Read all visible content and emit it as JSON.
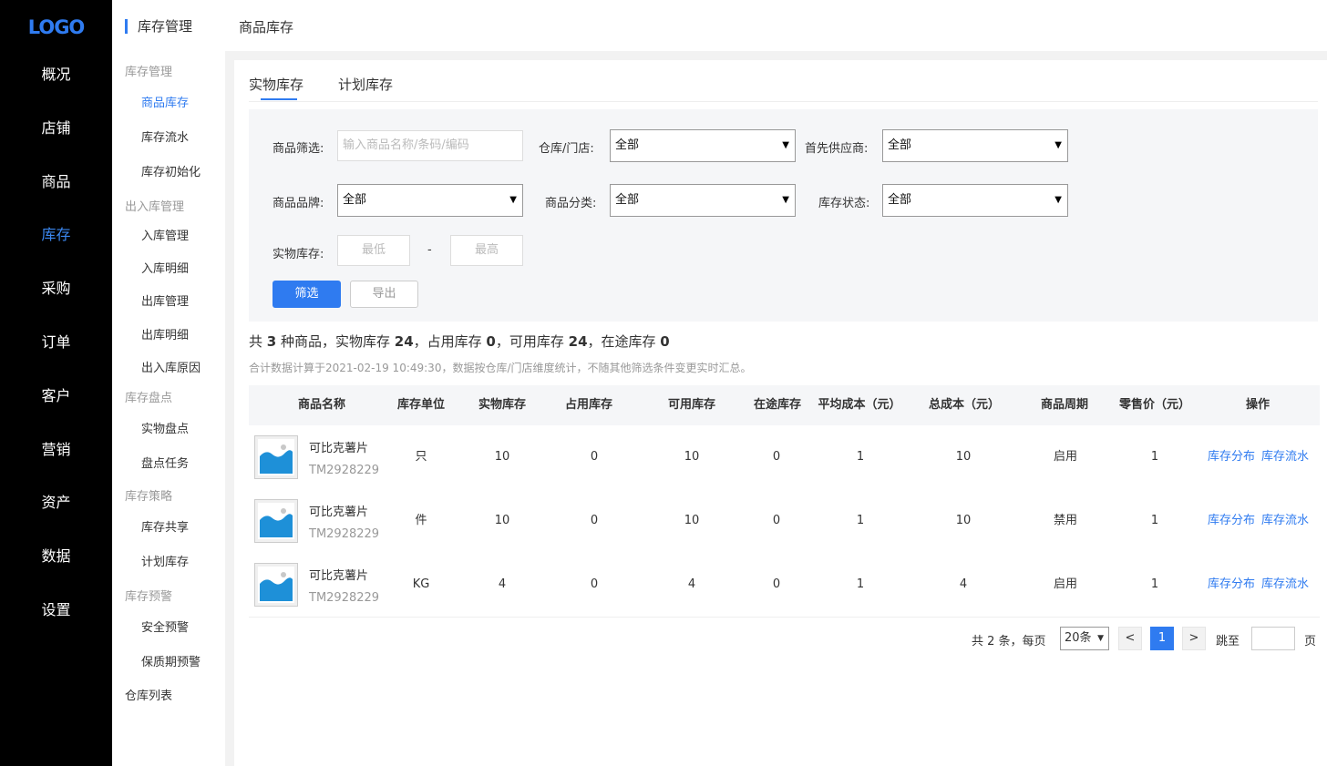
{
  "nav": {
    "logo": "LOGO",
    "items": [
      "概况",
      "店铺",
      "商品",
      "库存",
      "采购",
      "订单",
      "客户",
      "营销",
      "资产",
      "数据",
      "设置"
    ],
    "active_index": 3,
    "active_color": "#3b87ef"
  },
  "subnav": {
    "title": "库存管理",
    "groups": {
      "g1": "库存管理",
      "g1_items": [
        "商品库存",
        "库存流水",
        "库存初始化"
      ],
      "g2": "出入库管理",
      "g2_items": [
        "入库管理",
        "入库明细",
        "出库管理",
        "出库明细",
        "出入库原因"
      ],
      "g3": "库存盘点",
      "g3_items": [
        "实物盘点",
        "盘点任务"
      ],
      "g4": "库存策略",
      "g4_items": [
        "库存共享",
        "计划库存"
      ],
      "g5": "库存预警",
      "g5_items": [
        "安全预警",
        "保质期预警"
      ],
      "root": "仓库列表"
    }
  },
  "topbar": {
    "title": "商品库存"
  },
  "tabs": [
    "实物库存",
    "计划库存"
  ],
  "filter": {
    "product_label": "商品筛选:",
    "product_placeholder": "输入商品名称/条码/编码",
    "warehouse_label": "仓库/门店:",
    "warehouse_value": "全部",
    "supplier_label": "首先供应商:",
    "supplier_value": "全部",
    "brand_label": "商品品牌:",
    "brand_value": "全部",
    "category_label": "商品分类:",
    "category_value": "全部",
    "status_label": "库存状态:",
    "status_value": "全部",
    "stock_label": "实物库存:",
    "min_placeholder": "最低",
    "max_placeholder": "最高",
    "dash": "-",
    "filter_button": "筛选",
    "export_button": "导出"
  },
  "summary": {
    "p1": "共 ",
    "kinds": "3",
    "p2": " 种商品，实物库存 ",
    "physical": "24",
    "p3": "，占用库存 ",
    "occupied": "0",
    "p4": "，可用库存 ",
    "available": "24",
    "p5": "，在途库存 ",
    "transit": "0",
    "note": "合计数据计算于2021-02-19 10:49:30，数据按仓库/门店维度统计，不随其他筛选条件变更实时汇总。"
  },
  "table": {
    "headers": [
      "商品名称",
      "库存单位",
      "实物库存",
      "占用库存",
      "可用库存",
      "在途库存",
      "平均成本（元）",
      "总成本（元）",
      "商品周期",
      "零售价（元）",
      "操作"
    ],
    "rows": [
      {
        "name": "可比克薯片",
        "code": "TM2928229",
        "unit": "只",
        "physical": "10",
        "occupied": "0",
        "available": "10",
        "transit": "0",
        "avg_cost": "1",
        "total_cost": "10",
        "cycle": "启用",
        "price": "1"
      },
      {
        "name": "可比克薯片",
        "code": "TM2928229",
        "unit": "件",
        "physical": "10",
        "occupied": "0",
        "available": "10",
        "transit": "0",
        "avg_cost": "1",
        "total_cost": "10",
        "cycle": "禁用",
        "price": "1"
      },
      {
        "name": "可比克薯片",
        "code": "TM2928229",
        "unit": "KG",
        "physical": "4",
        "occupied": "0",
        "available": "4",
        "transit": "0",
        "avg_cost": "1",
        "total_cost": "4",
        "cycle": "启用",
        "price": "1"
      }
    ],
    "op_distribution": "库存分布",
    "op_flow": "库存流水"
  },
  "pagination": {
    "total_text": "共 2 条，每页",
    "per_page": "20条",
    "prev": "<",
    "current": "1",
    "next": ">",
    "jump_label": "跳至",
    "page_unit": "页"
  },
  "colors": {
    "accent": "#2f7bf0",
    "nav_bg": "#000000",
    "thumb_sky": "#1e90d8"
  }
}
